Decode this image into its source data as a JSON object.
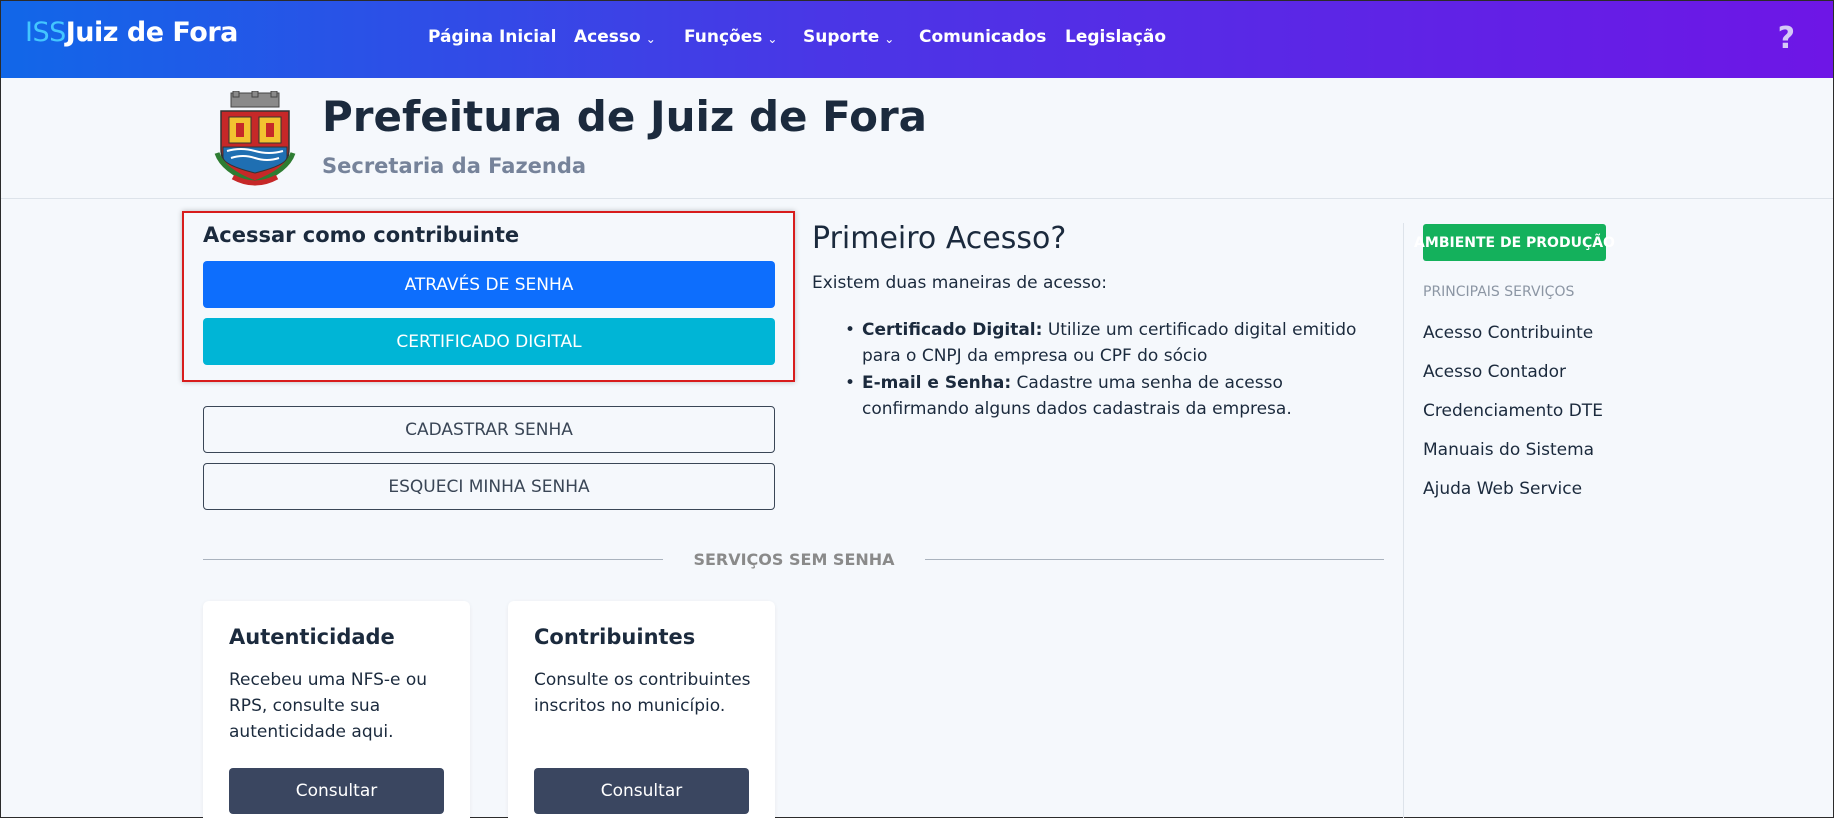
{
  "navbar": {
    "brand_prefix": "ISS",
    "brand_name": "Juiz de Fora",
    "items": [
      {
        "label": "Página Inicial",
        "dropdown": false
      },
      {
        "label": "Acesso",
        "dropdown": true
      },
      {
        "label": "Funções",
        "dropdown": true
      },
      {
        "label": "Suporte",
        "dropdown": true
      },
      {
        "label": "Comunicados",
        "dropdown": false
      },
      {
        "label": "Legislação",
        "dropdown": false
      }
    ],
    "help_label": "?"
  },
  "header": {
    "title": "Prefeitura de Juiz de Fora",
    "subtitle": "Secretaria da Fazenda"
  },
  "login": {
    "title": "Acessar como contribuinte",
    "senha_button": "ATRAVÉS DE SENHA",
    "certificado_button": "CERTIFICADO DIGITAL",
    "cadastrar_button": "CADASTRAR SENHA",
    "esqueci_button": "ESQUECI MINHA SENHA"
  },
  "primeiro_acesso": {
    "title": "Primeiro Acesso?",
    "intro": "Existem duas maneiras de acesso:",
    "items": [
      {
        "label": "Certificado Digital:",
        "text": " Utilize um certificado digital emitido para o CNPJ da empresa ou CPF do sócio"
      },
      {
        "label": "E-mail e Senha:",
        "text": " Cadastre uma senha de acesso confirmando alguns dados cadastrais da empresa."
      }
    ]
  },
  "servicos": {
    "divider_label": "SERVIÇOS SEM SENHA",
    "cards": [
      {
        "title": "Autenticidade",
        "text": "Recebeu uma NFS-e ou RPS, consulte sua autenticidade aqui.",
        "button": "Consultar"
      },
      {
        "title": "Contribuintes",
        "text": "Consulte os contribuintes inscritos no município.",
        "button": "Consultar"
      }
    ]
  },
  "sidebar": {
    "environment_badge": "AMBIENTE DE PRODUÇÃO",
    "heading": "PRINCIPAIS SERVIÇOS",
    "links": [
      "Acesso Contribuinte",
      "Acesso Contador",
      "Credenciamento DTE",
      "Manuais do Sistema",
      "Ajuda Web Service"
    ]
  },
  "colors": {
    "nav_gradient_start": "#1167e8",
    "nav_gradient_end": "#6e16e6",
    "primary": "#0d6efd",
    "info": "#00b5d6",
    "success": "#14b15c",
    "highlight_border": "#d81c1c"
  }
}
